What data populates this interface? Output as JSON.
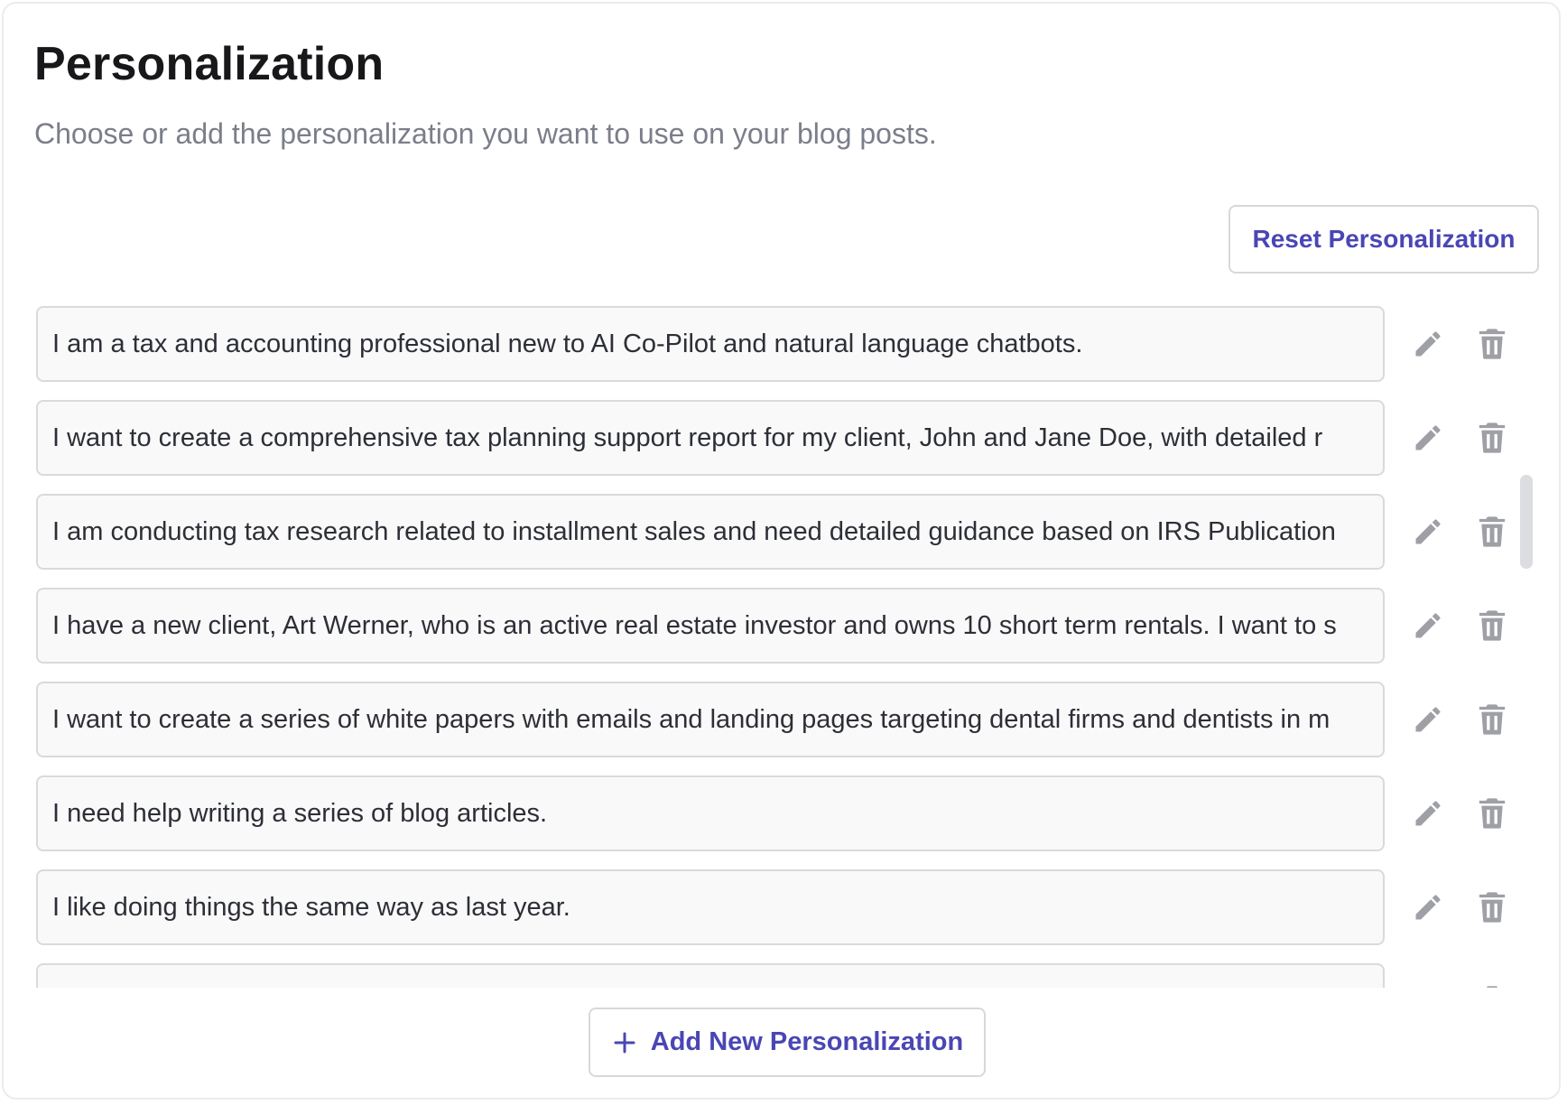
{
  "header": {
    "title": "Personalization",
    "subtitle": "Choose or add the personalization you want to use on your blog posts."
  },
  "actions": {
    "reset_label": "Reset Personalization",
    "add_label": "Add New Personalization"
  },
  "icons": {
    "edit": "pencil-icon",
    "delete": "trash-icon",
    "add": "plus-icon"
  },
  "colors": {
    "accent": "#4a46b4",
    "icon": "#9ea0a6",
    "input_bg": "#f9f9fa",
    "border": "#d9dadd"
  },
  "personalizations": [
    {
      "text": "I am a tax and accounting professional new to AI Co-Pilot and natural language chatbots."
    },
    {
      "text": "I want to create a comprehensive tax planning support report for my client, John and Jane Doe, with detailed r"
    },
    {
      "text": "I am conducting tax research related to installment sales and need detailed guidance based on IRS Publication"
    },
    {
      "text": "I have a new client, Art Werner, who is an active real estate investor and owns 10 short term rentals. I want to s"
    },
    {
      "text": "I want to create a series of white papers with emails and landing pages targeting dental firms and dentists in m"
    },
    {
      "text": "I need help writing a series of blog articles."
    },
    {
      "text": "I like doing things the same way as last year."
    },
    {
      "text": ""
    }
  ]
}
